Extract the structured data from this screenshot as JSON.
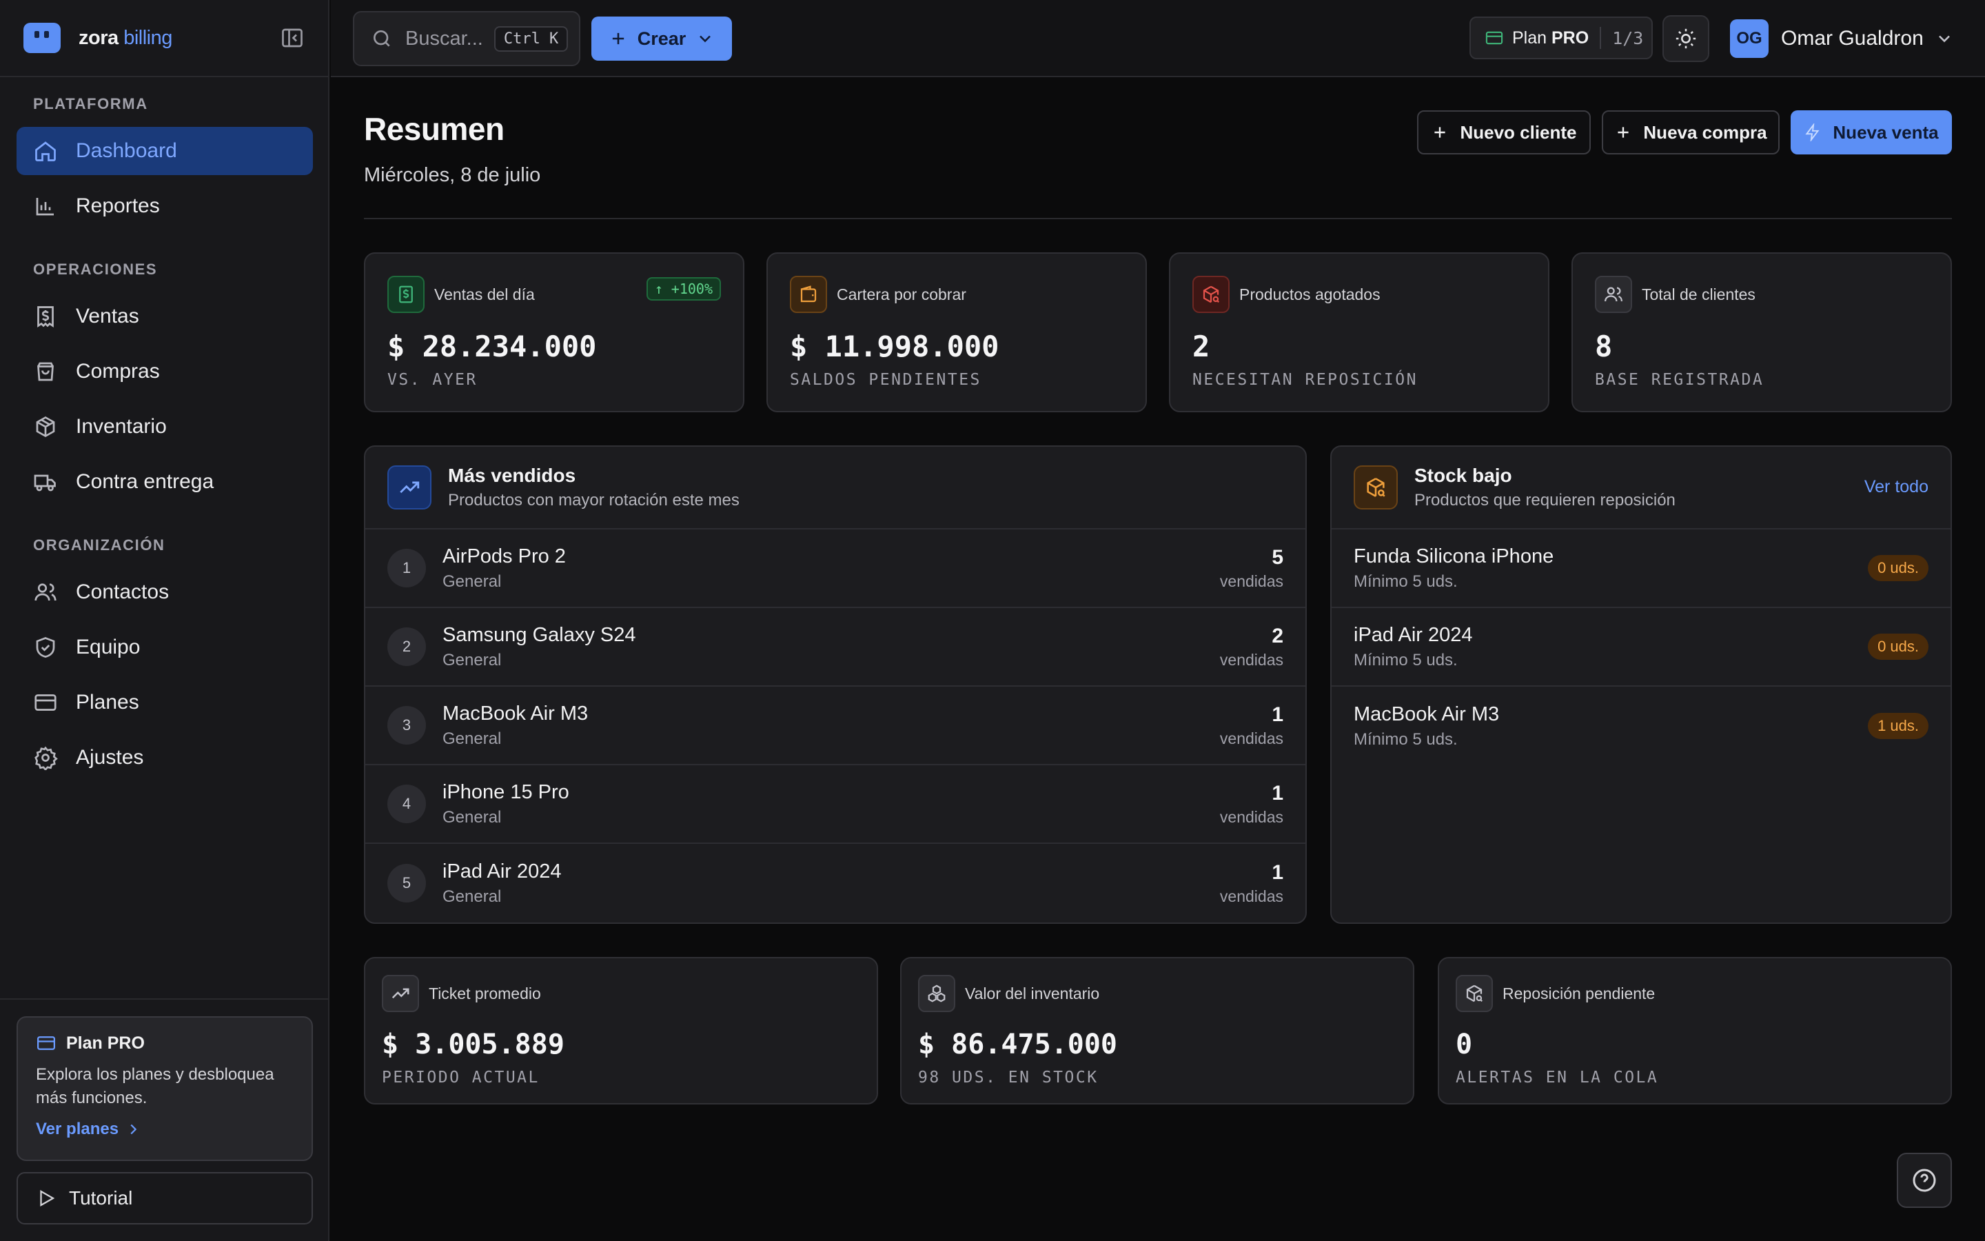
{
  "brand": {
    "name": "zora",
    "accent": "billing",
    "color": "#5c8ff5"
  },
  "sidebar": {
    "sections": [
      {
        "title": "PLATAFORMA"
      },
      {
        "title": "OPERACIONES"
      },
      {
        "title": "ORGANIZACIÓN"
      }
    ],
    "items": [
      {
        "label": "Dashboard",
        "icon": "home-icon"
      },
      {
        "label": "Reportes",
        "icon": "bar-chart-icon"
      },
      {
        "label": "Ventas",
        "icon": "receipt-dollar-icon"
      },
      {
        "label": "Compras",
        "icon": "shopping-bag-icon"
      },
      {
        "label": "Inventario",
        "icon": "package-icon"
      },
      {
        "label": "Contra entrega",
        "icon": "truck-icon"
      },
      {
        "label": "Contactos",
        "icon": "users-icon"
      },
      {
        "label": "Equipo",
        "icon": "shield-check-icon"
      },
      {
        "label": "Planes",
        "icon": "credit-card-icon"
      },
      {
        "label": "Ajustes",
        "icon": "gear-icon"
      }
    ],
    "plan_card": {
      "title": "Plan PRO",
      "text": "Explora los planes y desbloquea más funciones.",
      "link": "Ver planes"
    },
    "tutorial": "Tutorial"
  },
  "topbar": {
    "search_placeholder": "Buscar...",
    "search_shortcut": "Ctrl K",
    "create_label": "Crear",
    "plan_label": "Plan",
    "plan_tier": "PRO",
    "plan_count": "1/3",
    "user_initials": "OG",
    "user_name": "Omar Gualdron"
  },
  "page": {
    "title": "Resumen",
    "date": "Miércoles, 8 de julio",
    "actions": {
      "new_client": "Nuevo cliente",
      "new_purchase": "Nueva compra",
      "new_sale": "Nueva venta"
    }
  },
  "stats": [
    {
      "label": "Ventas del día",
      "value": "$ 28.234.000",
      "sub": "VS. AYER",
      "badge": "+100%",
      "color": "#3fb67a"
    },
    {
      "label": "Cartera por cobrar",
      "value": "$ 11.998.000",
      "sub": "SALDOS PENDIENTES",
      "color": "#f0a03c"
    },
    {
      "label": "Productos agotados",
      "value": "2",
      "sub": "NECESITAN REPOSICIÓN",
      "color": "#e5534b"
    },
    {
      "label": "Total de clientes",
      "value": "8",
      "sub": "BASE REGISTRADA",
      "color": "#a1a1aa"
    }
  ],
  "top_sellers": {
    "title": "Más vendidos",
    "subtitle": "Productos con mayor rotación este mes",
    "unit": "vendidas",
    "items": [
      {
        "rank": "1",
        "name": "AirPods Pro 2",
        "category": "General",
        "count": "5"
      },
      {
        "rank": "2",
        "name": "Samsung Galaxy S24",
        "category": "General",
        "count": "2"
      },
      {
        "rank": "3",
        "name": "MacBook Air M3",
        "category": "General",
        "count": "1"
      },
      {
        "rank": "4",
        "name": "iPhone 15 Pro",
        "category": "General",
        "count": "1"
      },
      {
        "rank": "5",
        "name": "iPad Air 2024",
        "category": "General",
        "count": "1"
      }
    ]
  },
  "low_stock": {
    "title": "Stock bajo",
    "subtitle": "Productos que requieren reposición",
    "link": "Ver todo",
    "items": [
      {
        "name": "Funda Silicona iPhone",
        "min": "Mínimo 5 uds.",
        "stock": "0 uds."
      },
      {
        "name": "iPad Air 2024",
        "min": "Mínimo 5 uds.",
        "stock": "0 uds."
      },
      {
        "name": "MacBook Air M3",
        "min": "Mínimo 5 uds.",
        "stock": "1 uds."
      }
    ]
  },
  "bottom_stats": [
    {
      "label": "Ticket promedio",
      "value": "$ 3.005.889",
      "sub": "PERIODO ACTUAL"
    },
    {
      "label": "Valor del inventario",
      "value": "$ 86.475.000",
      "sub": "98 UDS. EN STOCK"
    },
    {
      "label": "Reposición pendiente",
      "value": "0",
      "sub": "ALERTAS EN LA COLA"
    }
  ]
}
